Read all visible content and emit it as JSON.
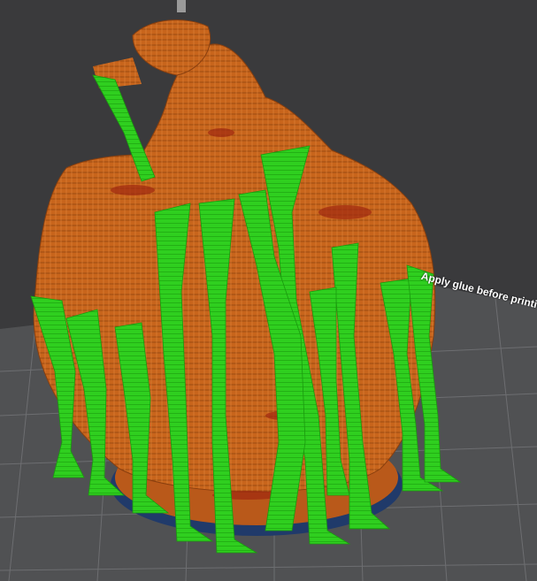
{
  "viewport": {
    "background_color": "#3a3a3c",
    "bed_color": "#505153",
    "grid_color": "#6d6e71",
    "model_color": "#c8651c",
    "support_color": "#2fcf1f",
    "base_plate_color": "#203a6a"
  },
  "bed": {
    "label": "Apply glue before printing"
  }
}
